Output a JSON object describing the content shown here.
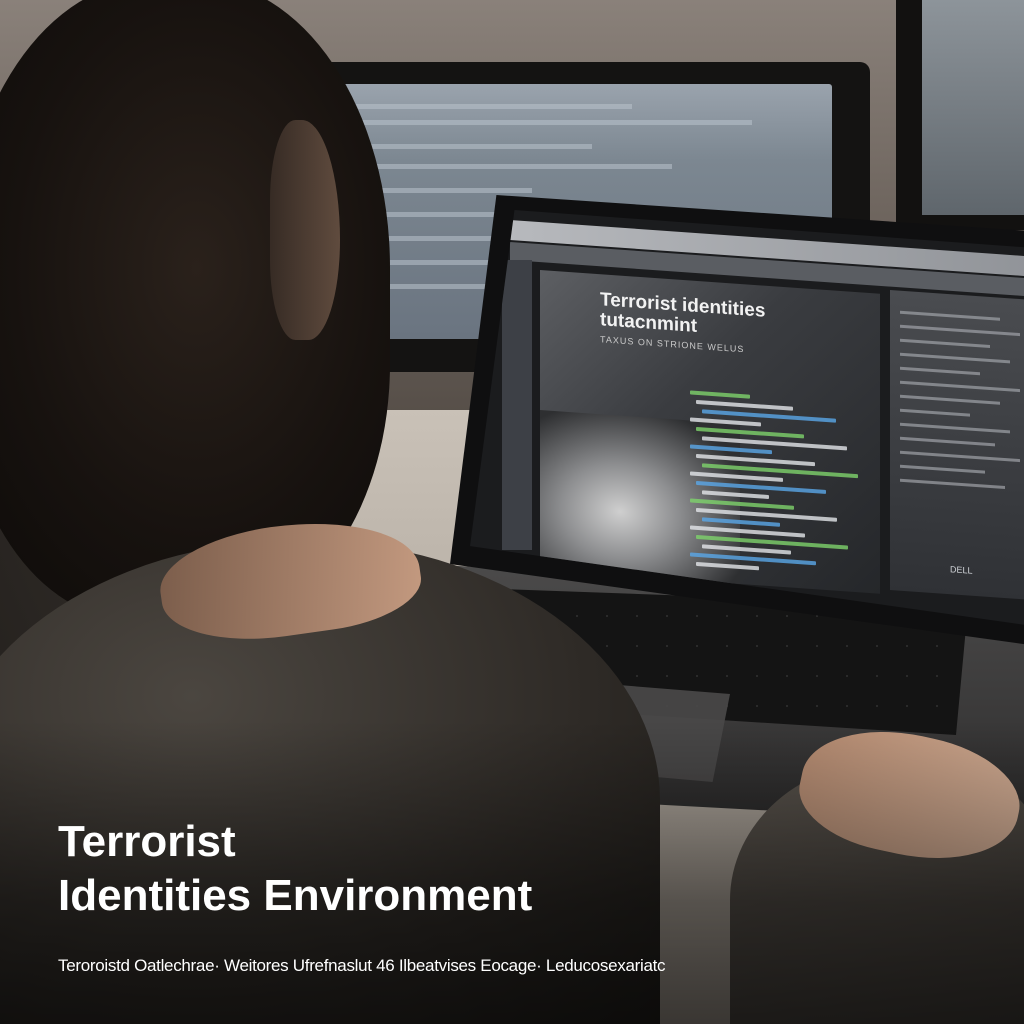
{
  "screen": {
    "doc_title_line1": "Terrorist identities",
    "doc_title_line2": "tutacnmint",
    "doc_subtitle": "TAXUS ON STRIONE WELUS",
    "brand_mark": "DELL"
  },
  "caption": {
    "title_line1": "Terrorist",
    "title_line2": "Identities Environment",
    "subtitle": "Teroroistd Oatlechrae· Weitores Ufrefnaslut 46 Ilbeatvises Eocage· Leducosexariatc"
  },
  "colors": {
    "code_green": "#7ed36b",
    "code_blue": "#5aa7e8",
    "code_white": "#e4e6ea",
    "caption_text": "#ffffff"
  }
}
